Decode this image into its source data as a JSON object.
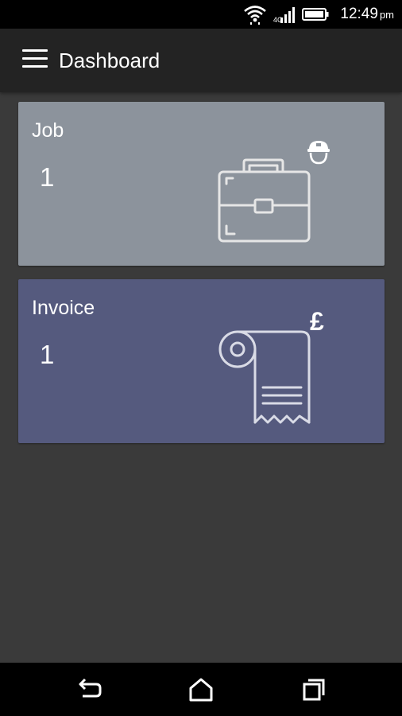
{
  "status_bar": {
    "time": "12:49",
    "ampm": "pm",
    "icons": [
      "wifi-icon",
      "signal-icon",
      "battery-icon"
    ]
  },
  "app_bar": {
    "title": "Dashboard",
    "menu_icon": "hamburger-menu-icon"
  },
  "cards": [
    {
      "label": "Job",
      "value": "1",
      "color": "#8c939c",
      "icon": "briefcase-icon",
      "badge_icon": "worker-cap-icon"
    },
    {
      "label": "Invoice",
      "value": "1",
      "color": "#555a7e",
      "icon": "receipt-roll-icon",
      "badge": "£"
    }
  ],
  "nav_bar": {
    "icons": [
      "back-icon",
      "home-icon",
      "recent-apps-icon"
    ]
  }
}
